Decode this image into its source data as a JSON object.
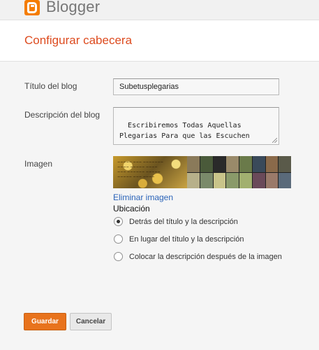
{
  "app": {
    "brand": "Blogger",
    "logo_icon": "blogger-logo-icon"
  },
  "dialog": {
    "title": "Configurar cabecera"
  },
  "form": {
    "title_label": "Título del blog",
    "title_value": "Subetusplegarias",
    "description_label": "Descripción del blog",
    "description_value": "Escribiremos Todas Aquellas\nPlegarias Para que las Escuchen",
    "image_label": "Imagen",
    "remove_image_link": "Eliminar imagen",
    "location_label": "Ubicación",
    "options": [
      {
        "label": "Detrás del título y la descripción",
        "checked": true
      },
      {
        "label": "En lugar del título y la descripción",
        "checked": false
      },
      {
        "label": "Colocar la descripción después de la imagen",
        "checked": false
      }
    ]
  },
  "buttons": {
    "save_label": "Guardar",
    "cancel_label": "Cancelar"
  },
  "colors": {
    "accent": "#dd4b1f",
    "primary_button": "#e8731d",
    "link": "#2a63b8"
  }
}
